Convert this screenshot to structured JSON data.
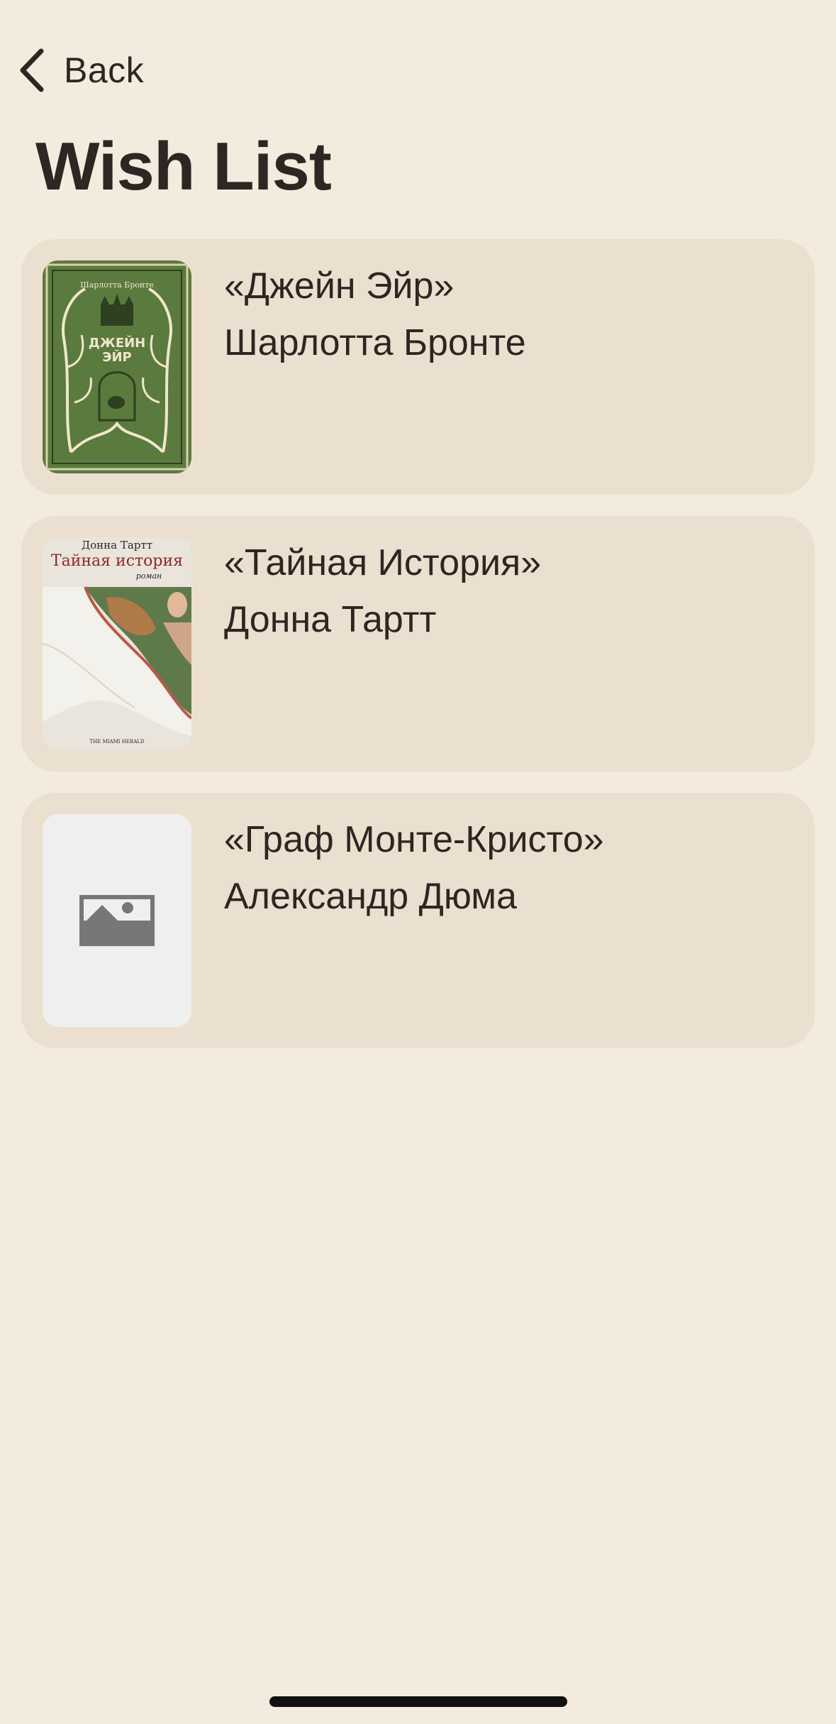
{
  "nav": {
    "back_label": "Back",
    "back_icon": "chevron-left-icon"
  },
  "page": {
    "title": "Wish List"
  },
  "books": [
    {
      "title": "«Джейн Эйр»",
      "author": "Шарлотта Бронте",
      "cover": {
        "type": "image",
        "author_line": "Шарлотта Бронте",
        "title_line1": "ДЖЕЙН",
        "title_line2": "ЭЙР",
        "colors": {
          "background": "#5b7a3e",
          "ornament": "#efe6cc"
        }
      }
    },
    {
      "title": "«Тайная История»",
      "author": "Донна Тартт",
      "cover": {
        "type": "image",
        "author_line": "Донна Тартт",
        "title_line": "Тайная история",
        "subtitle_line": "роман",
        "quote_line": "THE MIAMI HERALD",
        "colors": {
          "background": "#e9e4dc",
          "title": "#8c2a24"
        }
      }
    },
    {
      "title": "«Граф Монте-Кристо»",
      "author": "Александр Дюма",
      "cover": {
        "type": "placeholder",
        "icon": "image-placeholder-icon",
        "colors": {
          "background": "#efefef",
          "icon": "#777777"
        }
      }
    }
  ],
  "colors": {
    "background": "#f3ebdd",
    "card": "#ebe0cf",
    "text": "#2d2622",
    "home_indicator": "#111111"
  }
}
